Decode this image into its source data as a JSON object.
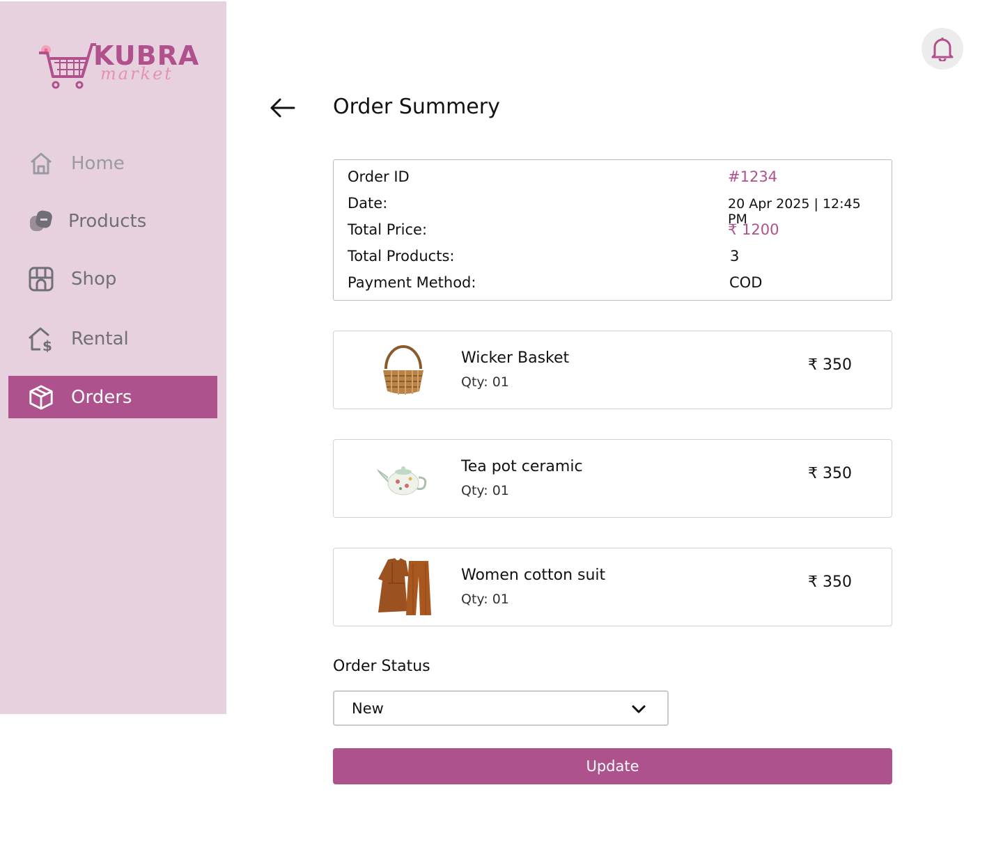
{
  "brand": {
    "name": "KUBRA",
    "tagline": "market",
    "accent_color": "#ad528d",
    "sidebar_bg": "#e8d1df"
  },
  "sidebar": {
    "items": [
      {
        "label": "Home",
        "icon": "home-icon",
        "active": false
      },
      {
        "label": "Products",
        "icon": "products-icon",
        "active": false
      },
      {
        "label": "Shop",
        "icon": "shop-icon",
        "active": false
      },
      {
        "label": "Rental",
        "icon": "rental-icon",
        "active": false
      },
      {
        "label": "Orders",
        "icon": "box-icon",
        "active": true
      }
    ]
  },
  "header": {
    "title": "Order Summery",
    "back_icon": "arrow-left-icon",
    "notification_icon": "bell-icon"
  },
  "summary": {
    "rows": [
      {
        "key": "Order ID",
        "value": "#1234"
      },
      {
        "key": "Date:",
        "value": "20 Apr 2025 | 12:45 PM"
      },
      {
        "key": "Total Price:",
        "value": "₹ 1200"
      },
      {
        "key": "Total Products:",
        "value": "3"
      },
      {
        "key": "Payment Method:",
        "value": "COD"
      }
    ]
  },
  "products": [
    {
      "name": "Wicker Basket",
      "qty": "Qty: 01",
      "price": "₹ 350",
      "image": "wicker-basket"
    },
    {
      "name": "Tea pot ceramic",
      "qty": "Qty: 01",
      "price": "₹ 350",
      "image": "tea-pot"
    },
    {
      "name": "Women cotton suit",
      "qty": "Qty: 01",
      "price": "₹ 350",
      "image": "cotton-suit"
    }
  ],
  "order_status": {
    "label": "Order Status",
    "selected": "New",
    "chevron_icon": "chevron-down-icon"
  },
  "actions": {
    "update_label": "Update"
  }
}
